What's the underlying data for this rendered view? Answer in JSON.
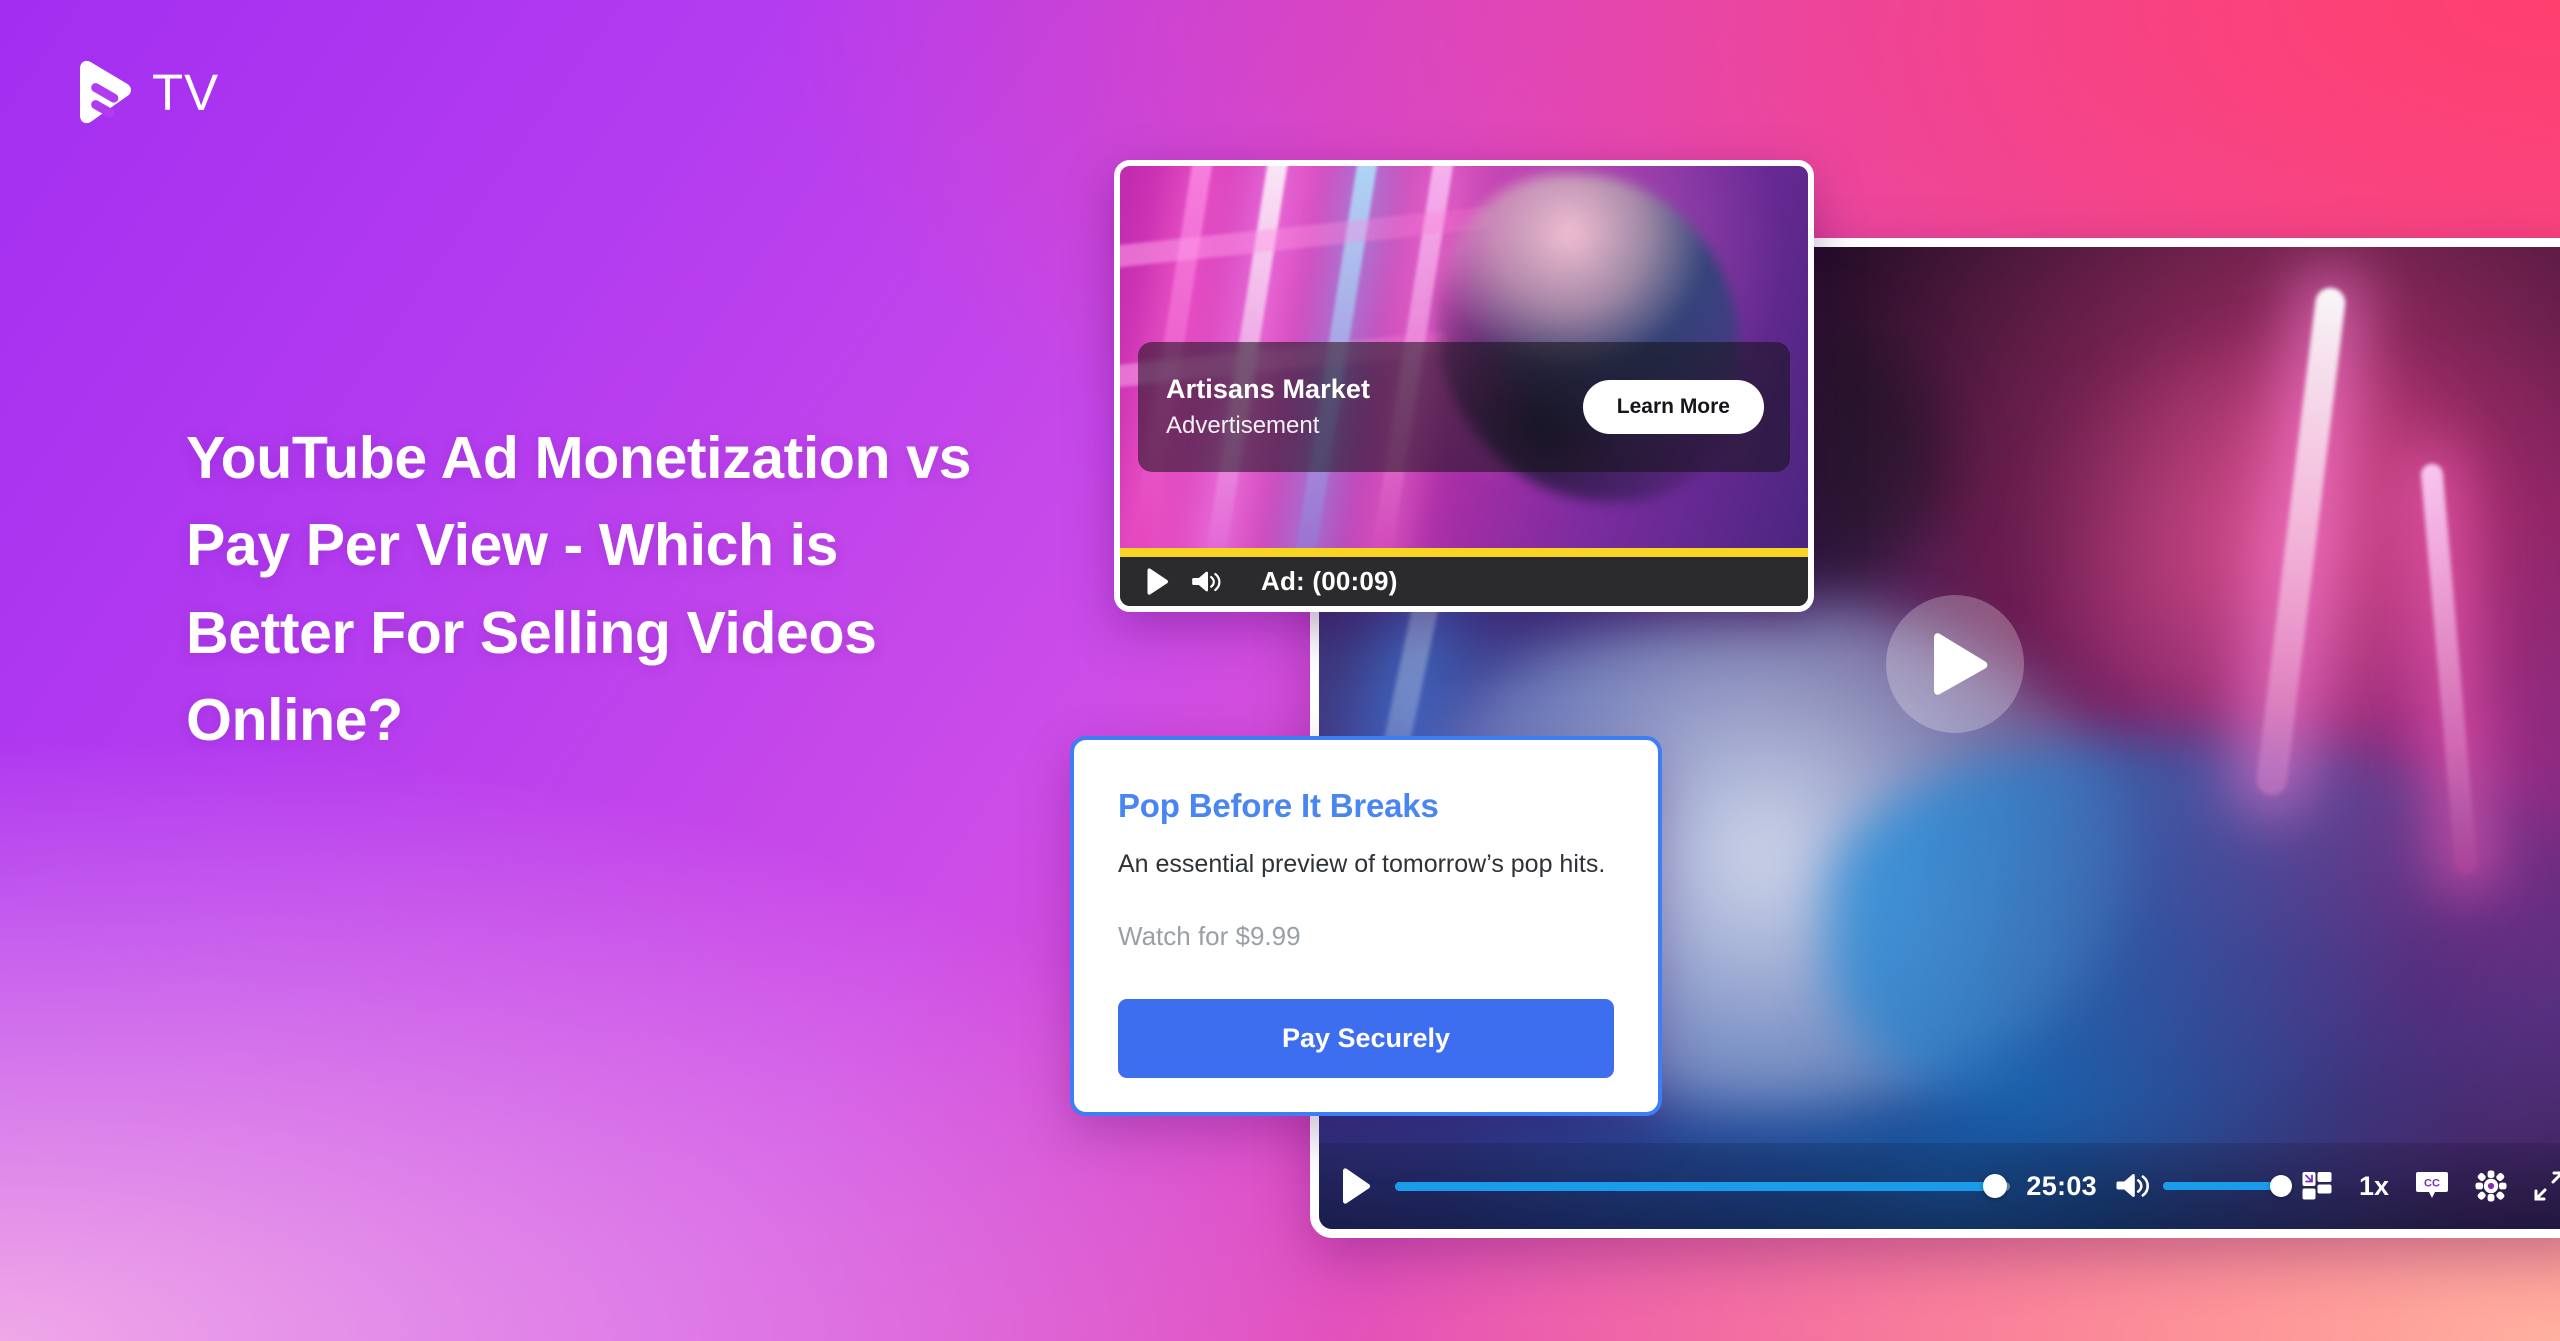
{
  "brand": {
    "mark_icon": "play-f-logo-icon",
    "wordmark": "TV"
  },
  "hero": {
    "headline": "YouTube Ad Monetization vs Pay Per View - Which is Better For Selling Videos Online?"
  },
  "ad_card": {
    "advertiser": "Artisans Market",
    "label": "Advertisement",
    "cta_label": "Learn More",
    "play_icon": "play-icon",
    "volume_icon": "volume-high-icon",
    "status_text": "Ad: (00:09)",
    "progress_color": "#f8d521",
    "progress_percent": 100
  },
  "ppv_card": {
    "title": "Pop Before It Breaks",
    "description": "An essential preview of tomorrow’s pop hits.",
    "price_text": "Watch for $9.99",
    "pay_label": "Pay Securely",
    "accent_color": "#3d6ef0",
    "border_color": "#3d7ef5"
  },
  "player": {
    "big_play_icon": "play-circle-icon",
    "play_icon": "play-icon",
    "seek_percent": 97.5,
    "time_label": "25:03",
    "volume_icon": "volume-high-icon",
    "volume_percent": 100,
    "miniplayer_icon": "miniplayer-icon",
    "speed_label": "1x",
    "captions_icon": "closed-captions-icon",
    "settings_icon": "gear-icon",
    "fullscreen_icon": "fullscreen-expand-icon",
    "accent_color": "#1b9ceb"
  },
  "theme": {
    "bg_purple": "#a32ef0",
    "bg_pink": "#ff3f6e",
    "bg_lavender": "#f0a8e8"
  }
}
